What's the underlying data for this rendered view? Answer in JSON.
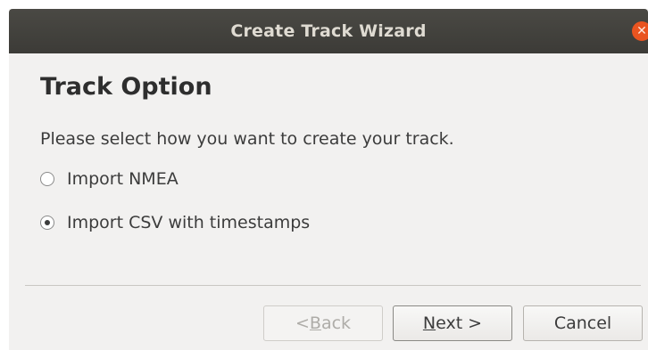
{
  "window": {
    "title": "Create Track Wizard",
    "close_icon": "close-icon",
    "accent_close": "#e95420"
  },
  "page": {
    "heading": "Track Option",
    "instruction": "Please select how you want to create your track."
  },
  "options": [
    {
      "label": "Import NMEA",
      "selected": false
    },
    {
      "label": "Import CSV with timestamps",
      "selected": true
    }
  ],
  "buttons": {
    "back": {
      "prefix": "< ",
      "mnemonic": "B",
      "rest": "ack",
      "enabled": false
    },
    "next": {
      "mnemonic": "N",
      "rest": "ext >",
      "enabled": true
    },
    "cancel": {
      "label": "Cancel",
      "enabled": true
    }
  }
}
